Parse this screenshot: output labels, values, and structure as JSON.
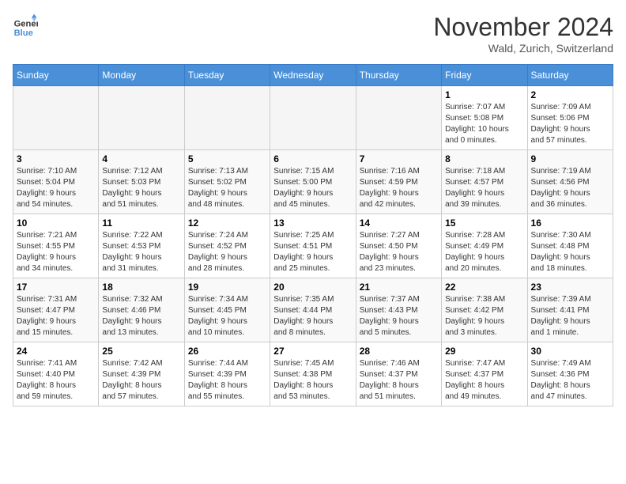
{
  "logo": {
    "line1": "General",
    "line2": "Blue"
  },
  "title": "November 2024",
  "subtitle": "Wald, Zurich, Switzerland",
  "days_of_week": [
    "Sunday",
    "Monday",
    "Tuesday",
    "Wednesday",
    "Thursday",
    "Friday",
    "Saturday"
  ],
  "weeks": [
    [
      {
        "day": "",
        "info": ""
      },
      {
        "day": "",
        "info": ""
      },
      {
        "day": "",
        "info": ""
      },
      {
        "day": "",
        "info": ""
      },
      {
        "day": "",
        "info": ""
      },
      {
        "day": "1",
        "info": "Sunrise: 7:07 AM\nSunset: 5:08 PM\nDaylight: 10 hours\nand 0 minutes."
      },
      {
        "day": "2",
        "info": "Sunrise: 7:09 AM\nSunset: 5:06 PM\nDaylight: 9 hours\nand 57 minutes."
      }
    ],
    [
      {
        "day": "3",
        "info": "Sunrise: 7:10 AM\nSunset: 5:04 PM\nDaylight: 9 hours\nand 54 minutes."
      },
      {
        "day": "4",
        "info": "Sunrise: 7:12 AM\nSunset: 5:03 PM\nDaylight: 9 hours\nand 51 minutes."
      },
      {
        "day": "5",
        "info": "Sunrise: 7:13 AM\nSunset: 5:02 PM\nDaylight: 9 hours\nand 48 minutes."
      },
      {
        "day": "6",
        "info": "Sunrise: 7:15 AM\nSunset: 5:00 PM\nDaylight: 9 hours\nand 45 minutes."
      },
      {
        "day": "7",
        "info": "Sunrise: 7:16 AM\nSunset: 4:59 PM\nDaylight: 9 hours\nand 42 minutes."
      },
      {
        "day": "8",
        "info": "Sunrise: 7:18 AM\nSunset: 4:57 PM\nDaylight: 9 hours\nand 39 minutes."
      },
      {
        "day": "9",
        "info": "Sunrise: 7:19 AM\nSunset: 4:56 PM\nDaylight: 9 hours\nand 36 minutes."
      }
    ],
    [
      {
        "day": "10",
        "info": "Sunrise: 7:21 AM\nSunset: 4:55 PM\nDaylight: 9 hours\nand 34 minutes."
      },
      {
        "day": "11",
        "info": "Sunrise: 7:22 AM\nSunset: 4:53 PM\nDaylight: 9 hours\nand 31 minutes."
      },
      {
        "day": "12",
        "info": "Sunrise: 7:24 AM\nSunset: 4:52 PM\nDaylight: 9 hours\nand 28 minutes."
      },
      {
        "day": "13",
        "info": "Sunrise: 7:25 AM\nSunset: 4:51 PM\nDaylight: 9 hours\nand 25 minutes."
      },
      {
        "day": "14",
        "info": "Sunrise: 7:27 AM\nSunset: 4:50 PM\nDaylight: 9 hours\nand 23 minutes."
      },
      {
        "day": "15",
        "info": "Sunrise: 7:28 AM\nSunset: 4:49 PM\nDaylight: 9 hours\nand 20 minutes."
      },
      {
        "day": "16",
        "info": "Sunrise: 7:30 AM\nSunset: 4:48 PM\nDaylight: 9 hours\nand 18 minutes."
      }
    ],
    [
      {
        "day": "17",
        "info": "Sunrise: 7:31 AM\nSunset: 4:47 PM\nDaylight: 9 hours\nand 15 minutes."
      },
      {
        "day": "18",
        "info": "Sunrise: 7:32 AM\nSunset: 4:46 PM\nDaylight: 9 hours\nand 13 minutes."
      },
      {
        "day": "19",
        "info": "Sunrise: 7:34 AM\nSunset: 4:45 PM\nDaylight: 9 hours\nand 10 minutes."
      },
      {
        "day": "20",
        "info": "Sunrise: 7:35 AM\nSunset: 4:44 PM\nDaylight: 9 hours\nand 8 minutes."
      },
      {
        "day": "21",
        "info": "Sunrise: 7:37 AM\nSunset: 4:43 PM\nDaylight: 9 hours\nand 5 minutes."
      },
      {
        "day": "22",
        "info": "Sunrise: 7:38 AM\nSunset: 4:42 PM\nDaylight: 9 hours\nand 3 minutes."
      },
      {
        "day": "23",
        "info": "Sunrise: 7:39 AM\nSunset: 4:41 PM\nDaylight: 9 hours\nand 1 minute."
      }
    ],
    [
      {
        "day": "24",
        "info": "Sunrise: 7:41 AM\nSunset: 4:40 PM\nDaylight: 8 hours\nand 59 minutes."
      },
      {
        "day": "25",
        "info": "Sunrise: 7:42 AM\nSunset: 4:39 PM\nDaylight: 8 hours\nand 57 minutes."
      },
      {
        "day": "26",
        "info": "Sunrise: 7:44 AM\nSunset: 4:39 PM\nDaylight: 8 hours\nand 55 minutes."
      },
      {
        "day": "27",
        "info": "Sunrise: 7:45 AM\nSunset: 4:38 PM\nDaylight: 8 hours\nand 53 minutes."
      },
      {
        "day": "28",
        "info": "Sunrise: 7:46 AM\nSunset: 4:37 PM\nDaylight: 8 hours\nand 51 minutes."
      },
      {
        "day": "29",
        "info": "Sunrise: 7:47 AM\nSunset: 4:37 PM\nDaylight: 8 hours\nand 49 minutes."
      },
      {
        "day": "30",
        "info": "Sunrise: 7:49 AM\nSunset: 4:36 PM\nDaylight: 8 hours\nand 47 minutes."
      }
    ]
  ]
}
